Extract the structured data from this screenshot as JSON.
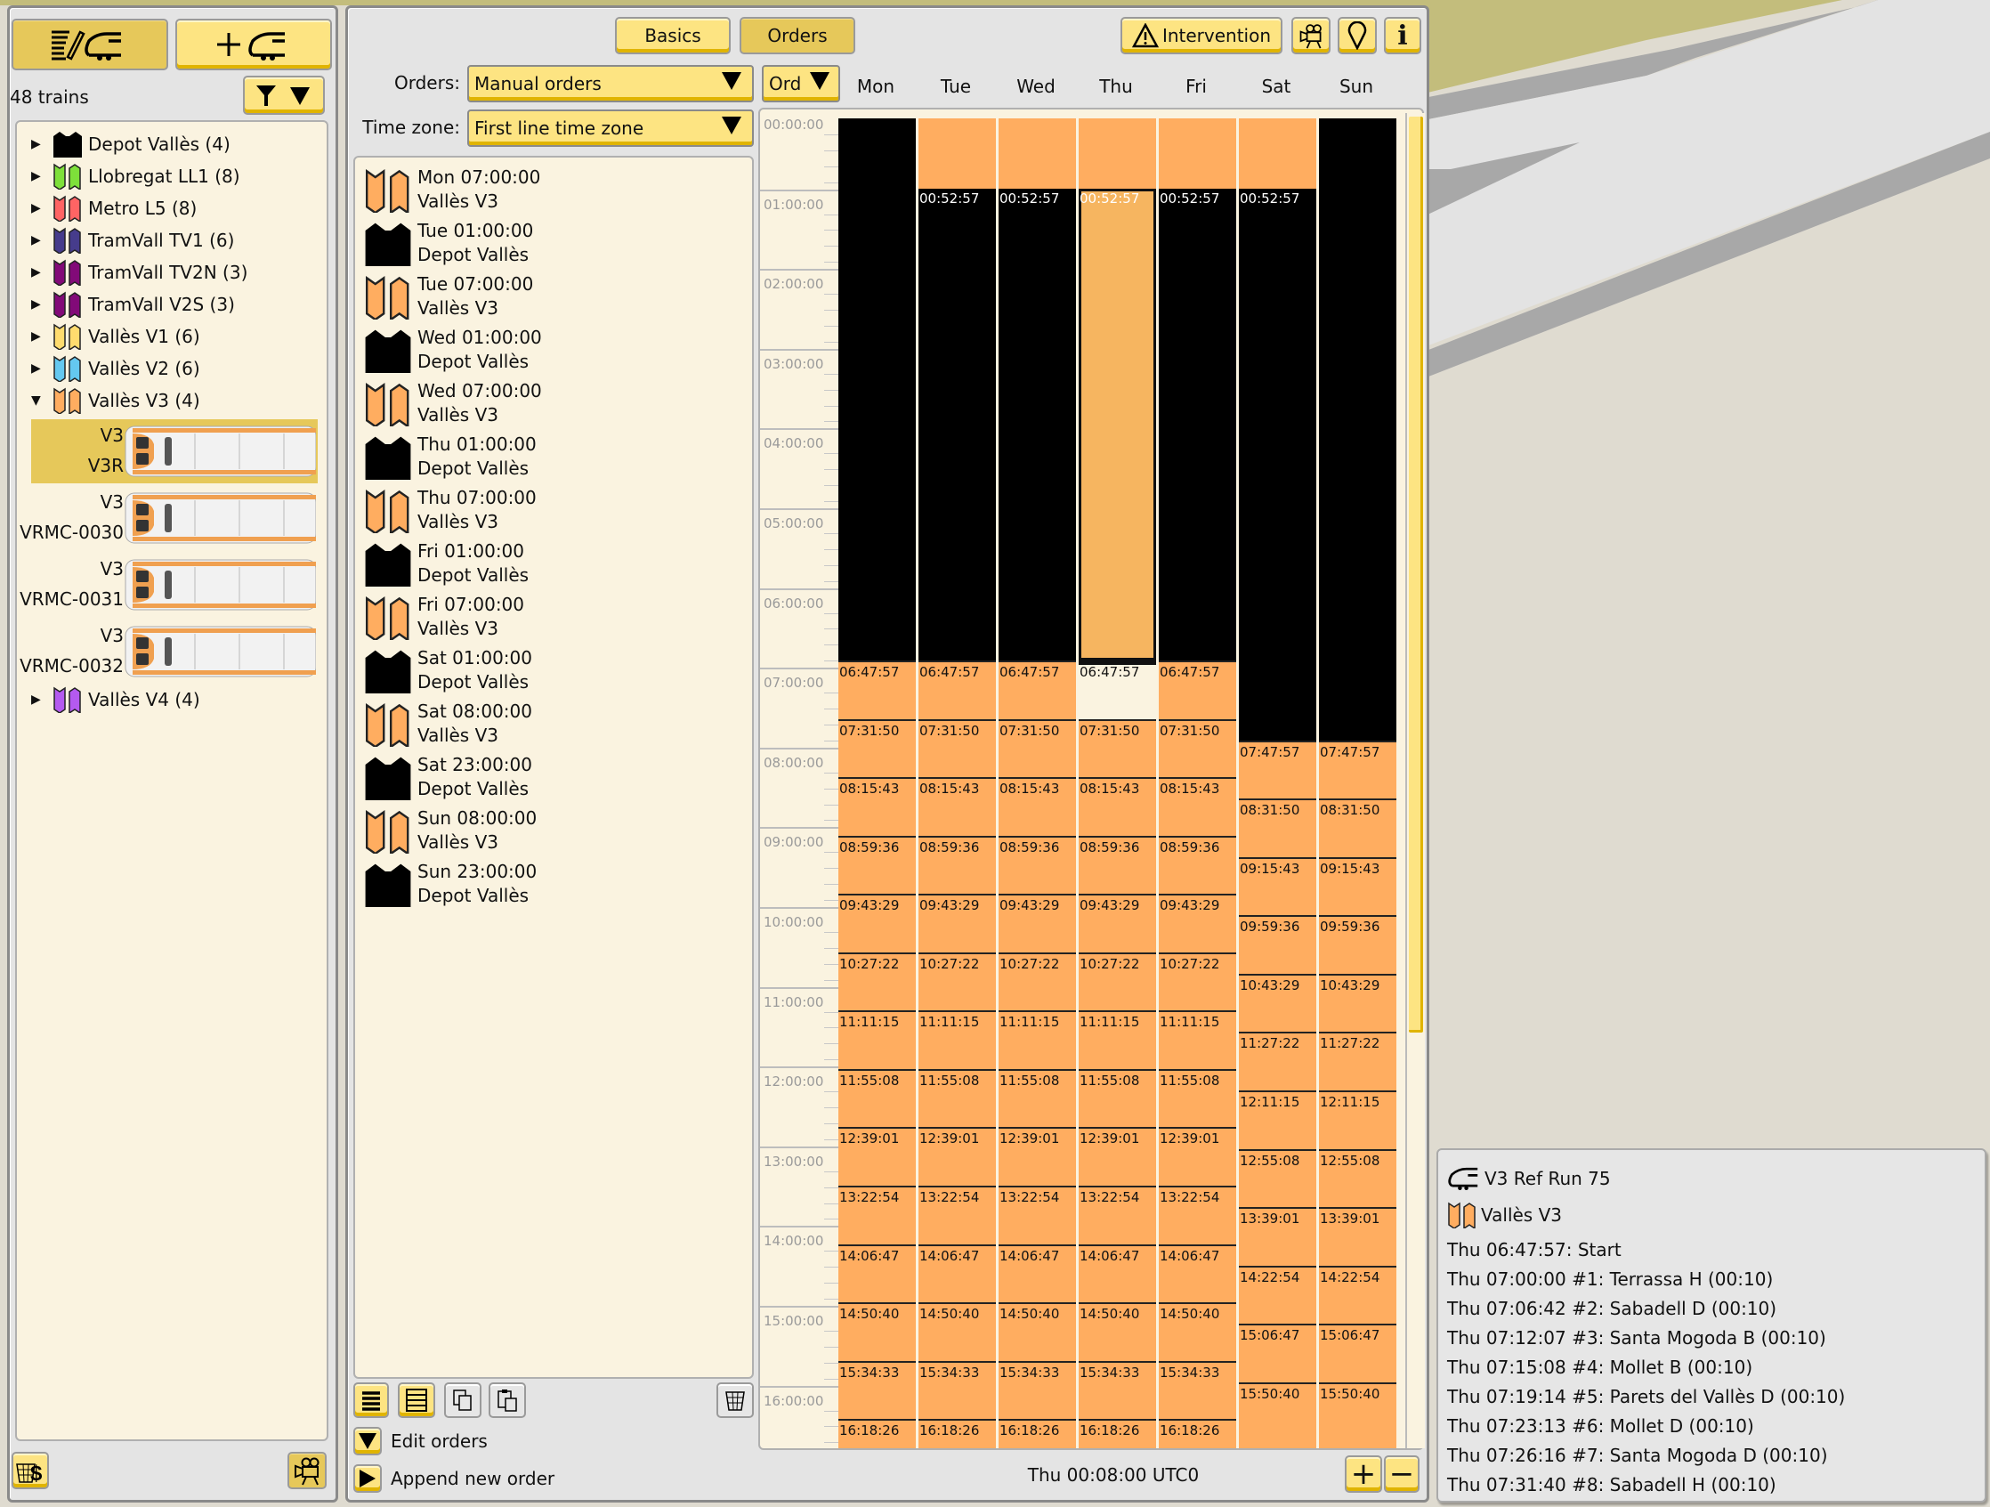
{
  "colors": {
    "button_yellow": "#fde482",
    "button_active": "#e6c85a",
    "panel_bg": "#e4e4e4",
    "well_bg": "#faf3e0",
    "run_block": "#ffad60",
    "depot_block": "#000000",
    "selected_block": "#f6b560"
  },
  "left_panel": {
    "train_count": "48 trains",
    "top_buttons": [
      {
        "icon": "edit-train-list-icon",
        "active": true
      },
      {
        "icon": "add-train-icon",
        "active": false
      }
    ],
    "filter_icon": "filter-icon",
    "lines": [
      {
        "label": "Depot Vallès (4)",
        "color": "#000000",
        "type": "depot",
        "expanded": false
      },
      {
        "label": "Llobregat LL1 (8)",
        "color": "#7ee03a",
        "type": "line",
        "expanded": false
      },
      {
        "label": "Metro L5 (8)",
        "color": "#ff6464",
        "type": "line",
        "expanded": false
      },
      {
        "label": "TramVall TV1 (6)",
        "color": "#463c8c",
        "type": "line",
        "expanded": false
      },
      {
        "label": "TramVall TV2N (3)",
        "color": "#820a78",
        "type": "line",
        "expanded": false
      },
      {
        "label": "TramVall V2S (3)",
        "color": "#820a78",
        "type": "line",
        "expanded": false
      },
      {
        "label": "Vallès V1 (6)",
        "color": "#ffdc6e",
        "type": "line",
        "expanded": false
      },
      {
        "label": "Vallès V2 (6)",
        "color": "#64c8f0",
        "type": "line",
        "expanded": false
      },
      {
        "label": "Vallès V3 (4)",
        "color": "#ffad60",
        "type": "line",
        "expanded": true
      },
      {
        "label": "Vallès V4 (4)",
        "color": "#b45af0",
        "type": "line",
        "expanded": false
      }
    ],
    "trains": [
      {
        "line": "V3",
        "name": "V3R",
        "selected": true
      },
      {
        "line": "V3",
        "name": "VRMC-0030",
        "selected": false
      },
      {
        "line": "V3",
        "name": "VRMC-0031",
        "selected": false
      },
      {
        "line": "V3",
        "name": "VRMC-0032",
        "selected": false
      }
    ],
    "bottom_buttons": [
      {
        "icon": "sell-train-icon"
      },
      {
        "icon": "camera-follow-icon"
      }
    ]
  },
  "main_panel": {
    "tabs": [
      {
        "label": "Basics",
        "active": false
      },
      {
        "label": "Orders",
        "active": true
      }
    ],
    "intervention_label": "Intervention",
    "header_icons": [
      "camera-icon",
      "locate-icon",
      "info-icon"
    ],
    "orders_label": "Orders:",
    "orders_value": "Manual orders",
    "timezone_label": "Time zone:",
    "timezone_value": "First line time zone",
    "order_list": [
      {
        "time": "Mon 07:00:00",
        "target": "Vallès V3",
        "type": "line"
      },
      {
        "time": "Tue 01:00:00",
        "target": "Depot Vallès",
        "type": "depot"
      },
      {
        "time": "Tue 07:00:00",
        "target": "Vallès V3",
        "type": "line"
      },
      {
        "time": "Wed 01:00:00",
        "target": "Depot Vallès",
        "type": "depot"
      },
      {
        "time": "Wed 07:00:00",
        "target": "Vallès V3",
        "type": "line"
      },
      {
        "time": "Thu 01:00:00",
        "target": "Depot Vallès",
        "type": "depot"
      },
      {
        "time": "Thu 07:00:00",
        "target": "Vallès V3",
        "type": "line"
      },
      {
        "time": "Fri 01:00:00",
        "target": "Depot Vallès",
        "type": "depot"
      },
      {
        "time": "Fri 07:00:00",
        "target": "Vallès V3",
        "type": "line"
      },
      {
        "time": "Sat 01:00:00",
        "target": "Depot Vallès",
        "type": "depot"
      },
      {
        "time": "Sat 08:00:00",
        "target": "Vallès V3",
        "type": "line"
      },
      {
        "time": "Sat 23:00:00",
        "target": "Depot Vallès",
        "type": "depot"
      },
      {
        "time": "Sun 08:00:00",
        "target": "Vallès V3",
        "type": "line"
      },
      {
        "time": "Sun 23:00:00",
        "target": "Depot Vallès",
        "type": "depot"
      }
    ],
    "list_tools": [
      "list-compact-icon",
      "list-expanded-icon",
      "copy-icon",
      "paste-icon",
      "delete-icon"
    ],
    "edit_orders_label": "Edit orders",
    "append_order_label": "Append new order",
    "status_time": "Thu 00:08:00 UTC0",
    "zoom_in": "+",
    "zoom_out": "−",
    "timetable": {
      "sort_label": "Ord",
      "days": [
        "Mon",
        "Tue",
        "Wed",
        "Thu",
        "Fri",
        "Sat",
        "Sun"
      ],
      "axis_labels": [
        "00:00:00",
        "01:00:00",
        "02:00:00",
        "03:00:00",
        "04:00:00",
        "05:00:00",
        "06:00:00",
        "07:00:00",
        "08:00:00",
        "09:00:00",
        "10:00:00",
        "11:00:00",
        "12:00:00",
        "13:00:00",
        "14:00:00",
        "15:00:00",
        "16:00:00"
      ],
      "scroll_visible_fraction": 0.69,
      "selected": {
        "day": 3,
        "block": 1
      },
      "columns": [
        {
          "blocks": [
            {
              "type": "depot",
              "start": "00:00:00",
              "label": ""
            },
            {
              "type": "run",
              "start": "06:47:57",
              "label": "06:47:57"
            },
            {
              "type": "run",
              "start": "07:31:50",
              "label": "07:31:50"
            },
            {
              "type": "run",
              "start": "08:15:43",
              "label": "08:15:43"
            },
            {
              "type": "run",
              "start": "08:59:36",
              "label": "08:59:36"
            },
            {
              "type": "run",
              "start": "09:43:29",
              "label": "09:43:29"
            },
            {
              "type": "run",
              "start": "10:27:22",
              "label": "10:27:22"
            },
            {
              "type": "run",
              "start": "11:11:15",
              "label": "11:11:15"
            },
            {
              "type": "run",
              "start": "11:55:08",
              "label": "11:55:08"
            },
            {
              "type": "run",
              "start": "12:39:01",
              "label": "12:39:01"
            },
            {
              "type": "run",
              "start": "13:22:54",
              "label": "13:22:54"
            },
            {
              "type": "run",
              "start": "14:06:47",
              "label": "14:06:47"
            },
            {
              "type": "run",
              "start": "14:50:40",
              "label": "14:50:40"
            },
            {
              "type": "run",
              "start": "15:34:33",
              "label": "15:34:33"
            },
            {
              "type": "run",
              "start": "16:18:26",
              "label": "16:18:26"
            }
          ]
        },
        {
          "blocks": [
            {
              "type": "run",
              "start": "00:00:00",
              "label": ""
            },
            {
              "type": "depot",
              "start": "00:52:57",
              "label": "00:52:57"
            },
            {
              "type": "run",
              "start": "06:47:57",
              "label": "06:47:57"
            },
            {
              "type": "run",
              "start": "07:31:50",
              "label": "07:31:50"
            },
            {
              "type": "run",
              "start": "08:15:43",
              "label": "08:15:43"
            },
            {
              "type": "run",
              "start": "08:59:36",
              "label": "08:59:36"
            },
            {
              "type": "run",
              "start": "09:43:29",
              "label": "09:43:29"
            },
            {
              "type": "run",
              "start": "10:27:22",
              "label": "10:27:22"
            },
            {
              "type": "run",
              "start": "11:11:15",
              "label": "11:11:15"
            },
            {
              "type": "run",
              "start": "11:55:08",
              "label": "11:55:08"
            },
            {
              "type": "run",
              "start": "12:39:01",
              "label": "12:39:01"
            },
            {
              "type": "run",
              "start": "13:22:54",
              "label": "13:22:54"
            },
            {
              "type": "run",
              "start": "14:06:47",
              "label": "14:06:47"
            },
            {
              "type": "run",
              "start": "14:50:40",
              "label": "14:50:40"
            },
            {
              "type": "run",
              "start": "15:34:33",
              "label": "15:34:33"
            },
            {
              "type": "run",
              "start": "16:18:26",
              "label": "16:18:26"
            }
          ]
        },
        {
          "blocks": [
            {
              "type": "run",
              "start": "00:00:00",
              "label": ""
            },
            {
              "type": "depot",
              "start": "00:52:57",
              "label": "00:52:57"
            },
            {
              "type": "run",
              "start": "06:47:57",
              "label": "06:47:57"
            },
            {
              "type": "run",
              "start": "07:31:50",
              "label": "07:31:50"
            },
            {
              "type": "run",
              "start": "08:15:43",
              "label": "08:15:43"
            },
            {
              "type": "run",
              "start": "08:59:36",
              "label": "08:59:36"
            },
            {
              "type": "run",
              "start": "09:43:29",
              "label": "09:43:29"
            },
            {
              "type": "run",
              "start": "10:27:22",
              "label": "10:27:22"
            },
            {
              "type": "run",
              "start": "11:11:15",
              "label": "11:11:15"
            },
            {
              "type": "run",
              "start": "11:55:08",
              "label": "11:55:08"
            },
            {
              "type": "run",
              "start": "12:39:01",
              "label": "12:39:01"
            },
            {
              "type": "run",
              "start": "13:22:54",
              "label": "13:22:54"
            },
            {
              "type": "run",
              "start": "14:06:47",
              "label": "14:06:47"
            },
            {
              "type": "run",
              "start": "14:50:40",
              "label": "14:50:40"
            },
            {
              "type": "run",
              "start": "15:34:33",
              "label": "15:34:33"
            },
            {
              "type": "run",
              "start": "16:18:26",
              "label": "16:18:26"
            }
          ]
        },
        {
          "blocks": [
            {
              "type": "run",
              "start": "00:00:00",
              "label": ""
            },
            {
              "type": "depot",
              "start": "00:52:57",
              "label": "00:52:57"
            },
            {
              "type": "run",
              "start": "06:47:57",
              "label": "06:47:57"
            },
            {
              "type": "run",
              "start": "07:31:50",
              "label": "07:31:50"
            },
            {
              "type": "run",
              "start": "08:15:43",
              "label": "08:15:43"
            },
            {
              "type": "run",
              "start": "08:59:36",
              "label": "08:59:36"
            },
            {
              "type": "run",
              "start": "09:43:29",
              "label": "09:43:29"
            },
            {
              "type": "run",
              "start": "10:27:22",
              "label": "10:27:22"
            },
            {
              "type": "run",
              "start": "11:11:15",
              "label": "11:11:15"
            },
            {
              "type": "run",
              "start": "11:55:08",
              "label": "11:55:08"
            },
            {
              "type": "run",
              "start": "12:39:01",
              "label": "12:39:01"
            },
            {
              "type": "run",
              "start": "13:22:54",
              "label": "13:22:54"
            },
            {
              "type": "run",
              "start": "14:06:47",
              "label": "14:06:47"
            },
            {
              "type": "run",
              "start": "14:50:40",
              "label": "14:50:40"
            },
            {
              "type": "run",
              "start": "15:34:33",
              "label": "15:34:33"
            },
            {
              "type": "run",
              "start": "16:18:26",
              "label": "16:18:26"
            }
          ]
        },
        {
          "blocks": [
            {
              "type": "run",
              "start": "00:00:00",
              "label": ""
            },
            {
              "type": "depot",
              "start": "00:52:57",
              "label": "00:52:57"
            },
            {
              "type": "run",
              "start": "06:47:57",
              "label": "06:47:57"
            },
            {
              "type": "run",
              "start": "07:31:50",
              "label": "07:31:50"
            },
            {
              "type": "run",
              "start": "08:15:43",
              "label": "08:15:43"
            },
            {
              "type": "run",
              "start": "08:59:36",
              "label": "08:59:36"
            },
            {
              "type": "run",
              "start": "09:43:29",
              "label": "09:43:29"
            },
            {
              "type": "run",
              "start": "10:27:22",
              "label": "10:27:22"
            },
            {
              "type": "run",
              "start": "11:11:15",
              "label": "11:11:15"
            },
            {
              "type": "run",
              "start": "11:55:08",
              "label": "11:55:08"
            },
            {
              "type": "run",
              "start": "12:39:01",
              "label": "12:39:01"
            },
            {
              "type": "run",
              "start": "13:22:54",
              "label": "13:22:54"
            },
            {
              "type": "run",
              "start": "14:06:47",
              "label": "14:06:47"
            },
            {
              "type": "run",
              "start": "14:50:40",
              "label": "14:50:40"
            },
            {
              "type": "run",
              "start": "15:34:33",
              "label": "15:34:33"
            },
            {
              "type": "run",
              "start": "16:18:26",
              "label": "16:18:26"
            }
          ]
        },
        {
          "blocks": [
            {
              "type": "run",
              "start": "00:00:00",
              "label": ""
            },
            {
              "type": "depot",
              "start": "00:52:57",
              "label": "00:52:57"
            },
            {
              "type": "run",
              "start": "07:47:57",
              "label": "07:47:57"
            },
            {
              "type": "run",
              "start": "08:31:50",
              "label": "08:31:50"
            },
            {
              "type": "run",
              "start": "09:15:43",
              "label": "09:15:43"
            },
            {
              "type": "run",
              "start": "09:59:36",
              "label": "09:59:36"
            },
            {
              "type": "run",
              "start": "10:43:29",
              "label": "10:43:29"
            },
            {
              "type": "run",
              "start": "11:27:22",
              "label": "11:27:22"
            },
            {
              "type": "run",
              "start": "12:11:15",
              "label": "12:11:15"
            },
            {
              "type": "run",
              "start": "12:55:08",
              "label": "12:55:08"
            },
            {
              "type": "run",
              "start": "13:39:01",
              "label": "13:39:01"
            },
            {
              "type": "run",
              "start": "14:22:54",
              "label": "14:22:54"
            },
            {
              "type": "run",
              "start": "15:06:47",
              "label": "15:06:47"
            },
            {
              "type": "run",
              "start": "15:50:40",
              "label": "15:50:40"
            }
          ]
        },
        {
          "blocks": [
            {
              "type": "depot",
              "start": "00:00:00",
              "label": ""
            },
            {
              "type": "run",
              "start": "07:47:57",
              "label": "07:47:57"
            },
            {
              "type": "run",
              "start": "08:31:50",
              "label": "08:31:50"
            },
            {
              "type": "run",
              "start": "09:15:43",
              "label": "09:15:43"
            },
            {
              "type": "run",
              "start": "09:59:36",
              "label": "09:59:36"
            },
            {
              "type": "run",
              "start": "10:43:29",
              "label": "10:43:29"
            },
            {
              "type": "run",
              "start": "11:27:22",
              "label": "11:27:22"
            },
            {
              "type": "run",
              "start": "12:11:15",
              "label": "12:11:15"
            },
            {
              "type": "run",
              "start": "12:55:08",
              "label": "12:55:08"
            },
            {
              "type": "run",
              "start": "13:39:01",
              "label": "13:39:01"
            },
            {
              "type": "run",
              "start": "14:22:54",
              "label": "14:22:54"
            },
            {
              "type": "run",
              "start": "15:06:47",
              "label": "15:06:47"
            },
            {
              "type": "run",
              "start": "15:50:40",
              "label": "15:50:40"
            }
          ]
        }
      ]
    }
  },
  "tooltip": {
    "run_name": "V3 Ref Run 75",
    "line_name": "Vallès V3",
    "entries": [
      "Thu 06:47:57: Start",
      "Thu 07:00:00 #1: Terrassa H (00:10)",
      "Thu 07:06:42 #2: Sabadell D (00:10)",
      "Thu 07:12:07 #3: Santa Mogoda B (00:10)",
      "Thu 07:15:08 #4: Mollet B (00:10)",
      "Thu 07:19:14 #5: Parets del Vallès D (00:10)",
      "Thu 07:23:13 #6: Mollet D (00:10)",
      "Thu 07:26:16 #7: Santa Mogoda D (00:10)",
      "Thu 07:31:40 #8: Sabadell H (00:10)"
    ]
  }
}
